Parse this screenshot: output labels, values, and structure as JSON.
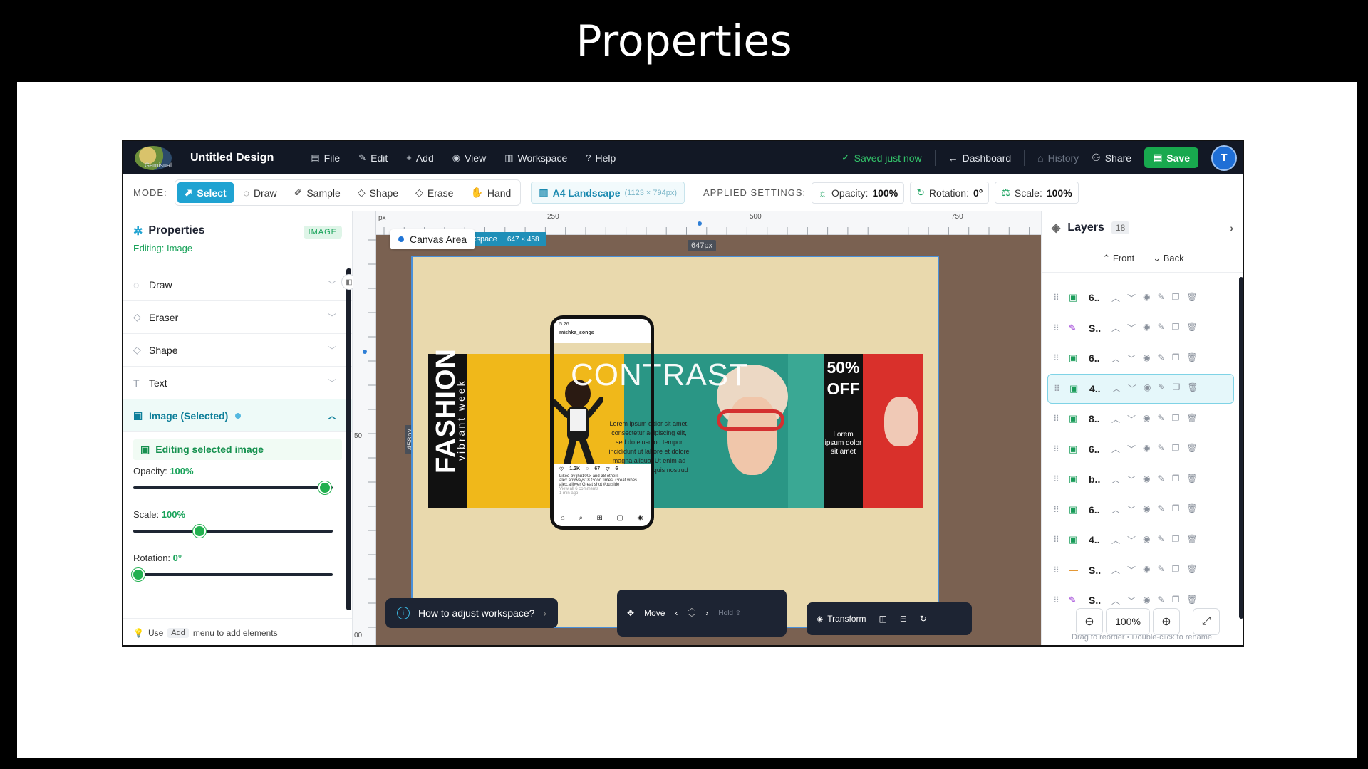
{
  "slide_title": "Properties",
  "topbar": {
    "logo_text": "Gamisual",
    "design_title": "Untitled Design",
    "menu": [
      {
        "label": "File",
        "icon": "file-icon"
      },
      {
        "label": "Edit",
        "icon": "pencil-icon"
      },
      {
        "label": "Add",
        "icon": "plus-icon"
      },
      {
        "label": "View",
        "icon": "eye-icon"
      },
      {
        "label": "Workspace",
        "icon": "layout-icon"
      },
      {
        "label": "Help",
        "icon": "help-circle-icon"
      }
    ],
    "saved_status": "Saved just now",
    "dashboard": "Dashboard",
    "history": "History",
    "share": "Share",
    "save": "Save",
    "avatar_initial": "T"
  },
  "modebar": {
    "mode_label": "MODE:",
    "modes": [
      "Select",
      "Draw",
      "Sample",
      "Shape",
      "Erase",
      "Hand"
    ],
    "active_mode": "Select",
    "page_size_label": "A4 Landscape",
    "page_size_dims": "(1123 × 794px)",
    "applied_label": "APPLIED SETTINGS:",
    "opacity_label": "Opacity:",
    "opacity_value": "100%",
    "rotation_label": "Rotation:",
    "rotation_value": "0°",
    "scale_label": "Scale:",
    "scale_value": "100%"
  },
  "leftpanel": {
    "title": "Properties",
    "badge": "IMAGE",
    "subtitle": "Editing: Image",
    "sections": [
      "Draw",
      "Eraser",
      "Shape",
      "Text"
    ],
    "selected_section": "Image (Selected)",
    "editing_box": "Editing selected image",
    "opacity_label": "Opacity:",
    "opacity_value": "100%",
    "opacity_fraction": 1.0,
    "scale_label": "Scale:",
    "scale_value": "100%",
    "scale_fraction": 0.33,
    "rotation_label": "Rotation:",
    "rotation_value": "0°",
    "rotation_fraction": 0.0,
    "footer_pre": "Use",
    "footer_key": "Add",
    "footer_post": "menu to add elements"
  },
  "canvas": {
    "ruler_unit": "px",
    "ruler_ticks": [
      "250",
      "500",
      "750"
    ],
    "left_ticks": [
      "50",
      "00"
    ],
    "canvas_chip": "Canvas Area",
    "workspace_label": "Workspace",
    "workspace_dims": "647 × 458",
    "width_label": "647px",
    "height_label": "458px",
    "art": {
      "fashion": "FASHION",
      "vibrant": "vibrant week",
      "contrast": "CONTRAST",
      "lorem": "Lorem ipsum dolor sit amet, consectetur adipiscing elit, sed do eiusmod tempor incididunt ut labore et dolore magna aliqua. Ut enim ad minim veniam, quis nostrud",
      "off_percent": "50%",
      "off_word": "OFF",
      "off_small": "Lorem ipsum dolor sit amet"
    },
    "phone": {
      "time": "5:26",
      "user": "mishka_songs",
      "likes": "1.2K",
      "comments": "67",
      "shares": "6",
      "liked_by": "Liked by jhu100x and 38 others",
      "caption": "alex.anyways18 Good times. Great vibes.",
      "caption2": "alex.allover Great shot #outside",
      "view_comments": "View all 6 comments",
      "time_ago": "1 min ago"
    },
    "help_text": "How to adjust workspace?",
    "move_label": "Move",
    "hold_label": "Hold ⇧",
    "transform_label": "Transform"
  },
  "rightpanel": {
    "title": "Layers",
    "count": "18",
    "front": "Front",
    "back": "Back",
    "layers": [
      {
        "name": "6..",
        "type": "image-icon",
        "glyph": "▣",
        "color": "#1a9c5a"
      },
      {
        "name": "S..",
        "type": "pen-icon",
        "glyph": "✎",
        "color": "#9b3cd6"
      },
      {
        "name": "6..",
        "type": "image-icon",
        "glyph": "▣",
        "color": "#1a9c5a"
      },
      {
        "name": "4..",
        "type": "image-icon",
        "glyph": "▣",
        "color": "#1a9c5a"
      },
      {
        "name": "8..",
        "type": "image-icon",
        "glyph": "▣",
        "color": "#1a9c5a"
      },
      {
        "name": "6..",
        "type": "image-icon",
        "glyph": "▣",
        "color": "#1a9c5a"
      },
      {
        "name": "b..",
        "type": "image-icon",
        "glyph": "▣",
        "color": "#1a9c5a"
      },
      {
        "name": "6..",
        "type": "image-icon",
        "glyph": "▣",
        "color": "#1a9c5a"
      },
      {
        "name": "4..",
        "type": "image-icon",
        "glyph": "▣",
        "color": "#1a9c5a"
      },
      {
        "name": "S..",
        "type": "line-icon",
        "glyph": "—",
        "color": "#e08a1a"
      },
      {
        "name": "S..",
        "type": "pen-icon",
        "glyph": "✎",
        "color": "#9b3cd6"
      }
    ],
    "active_index": 3,
    "zoom_value": "100%",
    "footer": "Drag to reorder • Double-click to rename"
  },
  "colors": {
    "accent": "#1fa3d2",
    "success": "#19a35a",
    "topbar_bg": "#121825"
  }
}
